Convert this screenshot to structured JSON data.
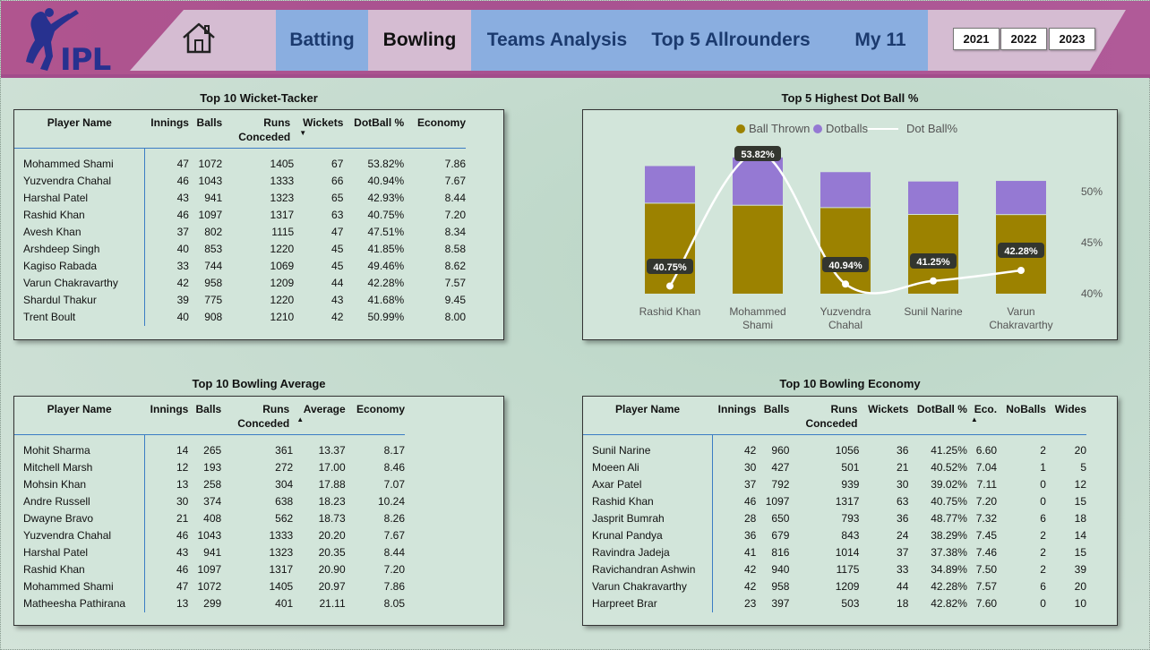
{
  "colors": {
    "header": "#a85190",
    "nav_blue": "#8aaee0",
    "nav_pink": "#d5bcd2",
    "bar_thrown": "#9c8200",
    "bar_dot": "#9579d3",
    "line": "#ffffff"
  },
  "header": {
    "logo_text": "IPL",
    "home_icon": "house-icon",
    "tabs": [
      "Batting",
      "Bowling",
      "Teams Analysis",
      "Top 5 Allrounders",
      "My 11"
    ],
    "years": [
      "2021",
      "2022",
      "2023"
    ]
  },
  "wickets": {
    "title": "Top 10 Wicket-Tacker",
    "columns": [
      "Player Name",
      "Innings",
      "Balls",
      "Runs Conceded",
      "Wickets",
      "DotBall %",
      "Economy"
    ],
    "rows": [
      [
        "Mohammed Shami",
        "47",
        "1072",
        "1405",
        "67",
        "53.82%",
        "7.86"
      ],
      [
        "Yuzvendra Chahal",
        "46",
        "1043",
        "1333",
        "66",
        "40.94%",
        "7.67"
      ],
      [
        "Harshal Patel",
        "43",
        "941",
        "1323",
        "65",
        "42.93%",
        "8.44"
      ],
      [
        "Rashid Khan",
        "46",
        "1097",
        "1317",
        "63",
        "40.75%",
        "7.20"
      ],
      [
        "Avesh Khan",
        "37",
        "802",
        "1115",
        "47",
        "47.51%",
        "8.34"
      ],
      [
        "Arshdeep Singh",
        "40",
        "853",
        "1220",
        "45",
        "41.85%",
        "8.58"
      ],
      [
        "Kagiso Rabada",
        "33",
        "744",
        "1069",
        "45",
        "49.46%",
        "8.62"
      ],
      [
        "Varun Chakravarthy",
        "42",
        "958",
        "1209",
        "44",
        "42.28%",
        "7.57"
      ],
      [
        "Shardul Thakur",
        "39",
        "775",
        "1220",
        "43",
        "41.68%",
        "9.45"
      ],
      [
        "Trent Boult",
        "40",
        "908",
        "1210",
        "42",
        "50.99%",
        "8.00"
      ]
    ]
  },
  "average": {
    "title": "Top 10 Bowling Average",
    "columns": [
      "Player Name",
      "Innings",
      "Balls",
      "Runs Conceded",
      "Average",
      "Economy"
    ],
    "rows": [
      [
        "Mohit Sharma",
        "14",
        "265",
        "361",
        "13.37",
        "8.17"
      ],
      [
        "Mitchell Marsh",
        "12",
        "193",
        "272",
        "17.00",
        "8.46"
      ],
      [
        "Mohsin Khan",
        "13",
        "258",
        "304",
        "17.88",
        "7.07"
      ],
      [
        "Andre Russell",
        "30",
        "374",
        "638",
        "18.23",
        "10.24"
      ],
      [
        "Dwayne Bravo",
        "21",
        "408",
        "562",
        "18.73",
        "8.26"
      ],
      [
        "Yuzvendra Chahal",
        "46",
        "1043",
        "1333",
        "20.20",
        "7.67"
      ],
      [
        "Harshal Patel",
        "43",
        "941",
        "1323",
        "20.35",
        "8.44"
      ],
      [
        "Rashid Khan",
        "46",
        "1097",
        "1317",
        "20.90",
        "7.20"
      ],
      [
        "Mohammed Shami",
        "47",
        "1072",
        "1405",
        "20.97",
        "7.86"
      ],
      [
        "Matheesha Pathirana",
        "13",
        "299",
        "401",
        "21.11",
        "8.05"
      ]
    ]
  },
  "economy": {
    "title": "Top 10 Bowling Economy",
    "columns": [
      "Player Name",
      "Innings",
      "Balls",
      "Runs Conceded",
      "Wickets",
      "DotBall %",
      "Eco.",
      "NoBalls",
      "Wides"
    ],
    "rows": [
      [
        "Sunil Narine",
        "42",
        "960",
        "1056",
        "36",
        "41.25%",
        "6.60",
        "2",
        "20"
      ],
      [
        "Moeen Ali",
        "30",
        "427",
        "501",
        "21",
        "40.52%",
        "7.04",
        "1",
        "5"
      ],
      [
        "Axar Patel",
        "37",
        "792",
        "939",
        "30",
        "39.02%",
        "7.11",
        "0",
        "12"
      ],
      [
        "Rashid Khan",
        "46",
        "1097",
        "1317",
        "63",
        "40.75%",
        "7.20",
        "0",
        "15"
      ],
      [
        "Jasprit Bumrah",
        "28",
        "650",
        "793",
        "36",
        "48.77%",
        "7.32",
        "6",
        "18"
      ],
      [
        "Krunal Pandya",
        "36",
        "679",
        "843",
        "24",
        "38.29%",
        "7.45",
        "2",
        "14"
      ],
      [
        "Ravindra Jadeja",
        "41",
        "816",
        "1014",
        "37",
        "37.38%",
        "7.46",
        "2",
        "15"
      ],
      [
        "Ravichandran Ashwin",
        "42",
        "940",
        "1175",
        "33",
        "34.89%",
        "7.50",
        "2",
        "39"
      ],
      [
        "Varun Chakravarthy",
        "42",
        "958",
        "1209",
        "44",
        "42.28%",
        "7.57",
        "6",
        "20"
      ],
      [
        "Harpreet Brar",
        "23",
        "397",
        "503",
        "18",
        "42.82%",
        "7.60",
        "0",
        "10"
      ]
    ]
  },
  "chart_data": {
    "type": "bar",
    "title": "Top 5 Highest Dot Ball %",
    "legend": [
      "Ball Thrown",
      "Dotballs",
      "Dot Ball%"
    ],
    "legend_position": "top",
    "categories": [
      "Rashid Khan",
      "Mohammed Shami",
      "Yuzvendra Chahal",
      "Sunil Narine",
      "Varun Chakravarthy"
    ],
    "category_lines": [
      [
        "Rashid Khan"
      ],
      [
        "Mohammed",
        "Shami"
      ],
      [
        "Yuzvendra",
        "Chahal"
      ],
      [
        "Sunil Narine"
      ],
      [
        "Varun",
        "Chakravarthy"
      ]
    ],
    "series": [
      {
        "name": "Ball Thrown",
        "values": [
          1097,
          1072,
          1043,
          960,
          958
        ]
      },
      {
        "name": "Dotballs",
        "values": [
          447,
          577,
          427,
          396,
          405
        ]
      }
    ],
    "line_series": {
      "name": "Dot Ball%",
      "values": [
        40.75,
        53.82,
        40.94,
        41.25,
        42.28
      ],
      "labels": [
        "40.75%",
        "53.82%",
        "40.94%",
        "41.25%",
        "42.28%"
      ]
    },
    "y_right_ticks": [
      "50%",
      "45%",
      "40%"
    ],
    "y_right_values": [
      50,
      45,
      40
    ],
    "grid": false
  }
}
